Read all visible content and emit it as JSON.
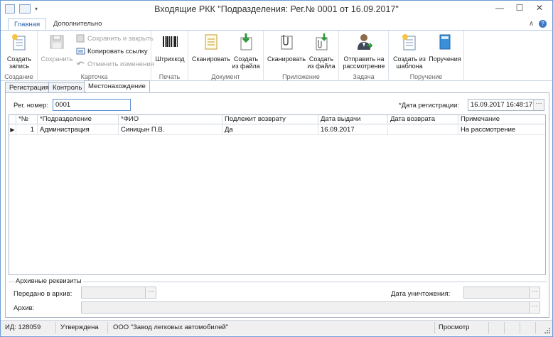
{
  "window": {
    "title": "Входящие РКК \"Подразделения: Рег.№ 0001 от 16.09.2017\"",
    "minimize": "—",
    "maximize": "☐",
    "close": "✕"
  },
  "ribbon_tabs": [
    {
      "label": "Главная",
      "active": true
    },
    {
      "label": "Дополнительно",
      "active": false
    }
  ],
  "ribbon": {
    "groups": {
      "create": "Создание",
      "card": "Карточка",
      "print": "Печать",
      "document": "Документ",
      "attachment": "Приложение",
      "task": "Задача",
      "assignment": "Поручение"
    },
    "buttons": {
      "create_record": "Создать запись",
      "save": "Сохранить",
      "save_close": "Сохранить и закрыть",
      "copy_link": "Копировать ссылку",
      "cancel_changes": "Отменить изменения",
      "barcode": "Штрихкод",
      "scan_doc": "Сканировать",
      "from_file_doc": "Создать из файла",
      "scan_att": "Сканировать",
      "from_file_att": "Создать из файла",
      "send_review": "Отправить на рассмотрение",
      "from_template": "Создать из шаблона",
      "assignments": "Поручения"
    }
  },
  "inner_tabs": [
    {
      "label": "Регистрация",
      "active": false
    },
    {
      "label": "Контроль",
      "active": false
    },
    {
      "label": "Местонахождение",
      "active": true
    }
  ],
  "form": {
    "reg_number_label": "Рег. номер:",
    "reg_number_value": "0001",
    "reg_date_label": "*Дата регистрации:",
    "reg_date_value": "16.09.2017 16:48:17"
  },
  "grid": {
    "columns": [
      "*№",
      "*Подразделение",
      "*ФИО",
      "Подлежит возврату",
      "Дата выдачи",
      "Дата возврата",
      "Примечание"
    ],
    "rows": [
      [
        "1",
        "Администрация",
        "Синицын П.В.",
        "Да",
        "16.09.2017",
        "",
        "На рассмотрение"
      ]
    ]
  },
  "archive": {
    "title": "Архивные реквизиты",
    "transferred_label": "Передано в архив:",
    "destroy_label": "Дата уничтожения:",
    "archive_label": "Архив:",
    "transferred_value": "",
    "destroy_value": "",
    "archive_value": ""
  },
  "status": {
    "id": "ИД: 128059",
    "state": "Утверждена",
    "org": "ООО \"Завод легковых автомобилей\"",
    "mode": "Просмотр"
  },
  "colors": {
    "accent": "#2a62b5",
    "border": "#aab6c6"
  }
}
